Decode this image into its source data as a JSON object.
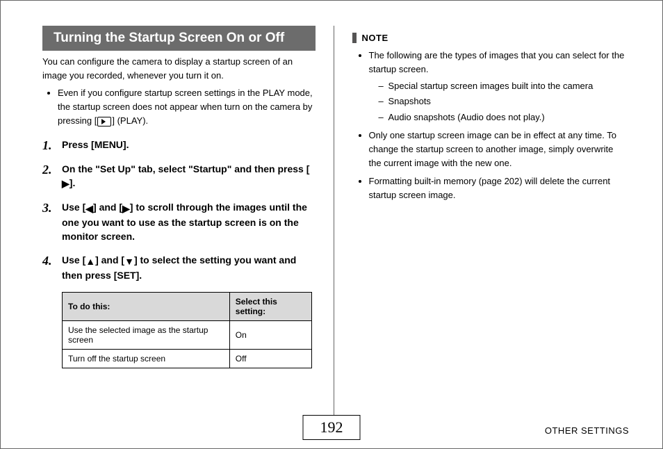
{
  "heading": "Turning the Startup Screen On or Off",
  "intro": "You can configure the camera to display a startup screen of an image you recorded, whenever you turn it on.",
  "intro_bullet_pre": "Even if you configure startup screen settings in the PLAY mode, the startup screen does not appear when turn on the camera by pressing [",
  "intro_bullet_post": "] (PLAY).",
  "steps": {
    "s1": "Press [MENU].",
    "s2_pre": "On the \"Set Up\" tab, select \"Startup\" and then press [",
    "s2_post": "].",
    "s3_pre": "Use [",
    "s3_mid": "] and [",
    "s3_post": "] to scroll through the images until the one you want to use as the startup screen is on the monitor screen.",
    "s4_pre": "Use [",
    "s4_mid": "] and [",
    "s4_post": "] to select the setting you want and then press [SET]."
  },
  "table": {
    "h1": "To do this:",
    "h2": "Select this setting:",
    "r1c1": "Use the selected image as the startup screen",
    "r1c2": "On",
    "r2c1": "Turn off the startup screen",
    "r2c2": "Off"
  },
  "note_label": "NOTE",
  "note": {
    "n1": "The following are the types of images that you can select for the startup screen.",
    "n1a": "Special startup screen images built into the camera",
    "n1b": "Snapshots",
    "n1c": "Audio snapshots (Audio does not play.)",
    "n2": "Only one startup screen image can be in effect at any time. To change the startup screen to another image, simply overwrite the current image with the new one.",
    "n3": "Formatting built-in memory (page 202) will delete the current startup screen image."
  },
  "page_number": "192",
  "footer_right": "OTHER SETTINGS"
}
